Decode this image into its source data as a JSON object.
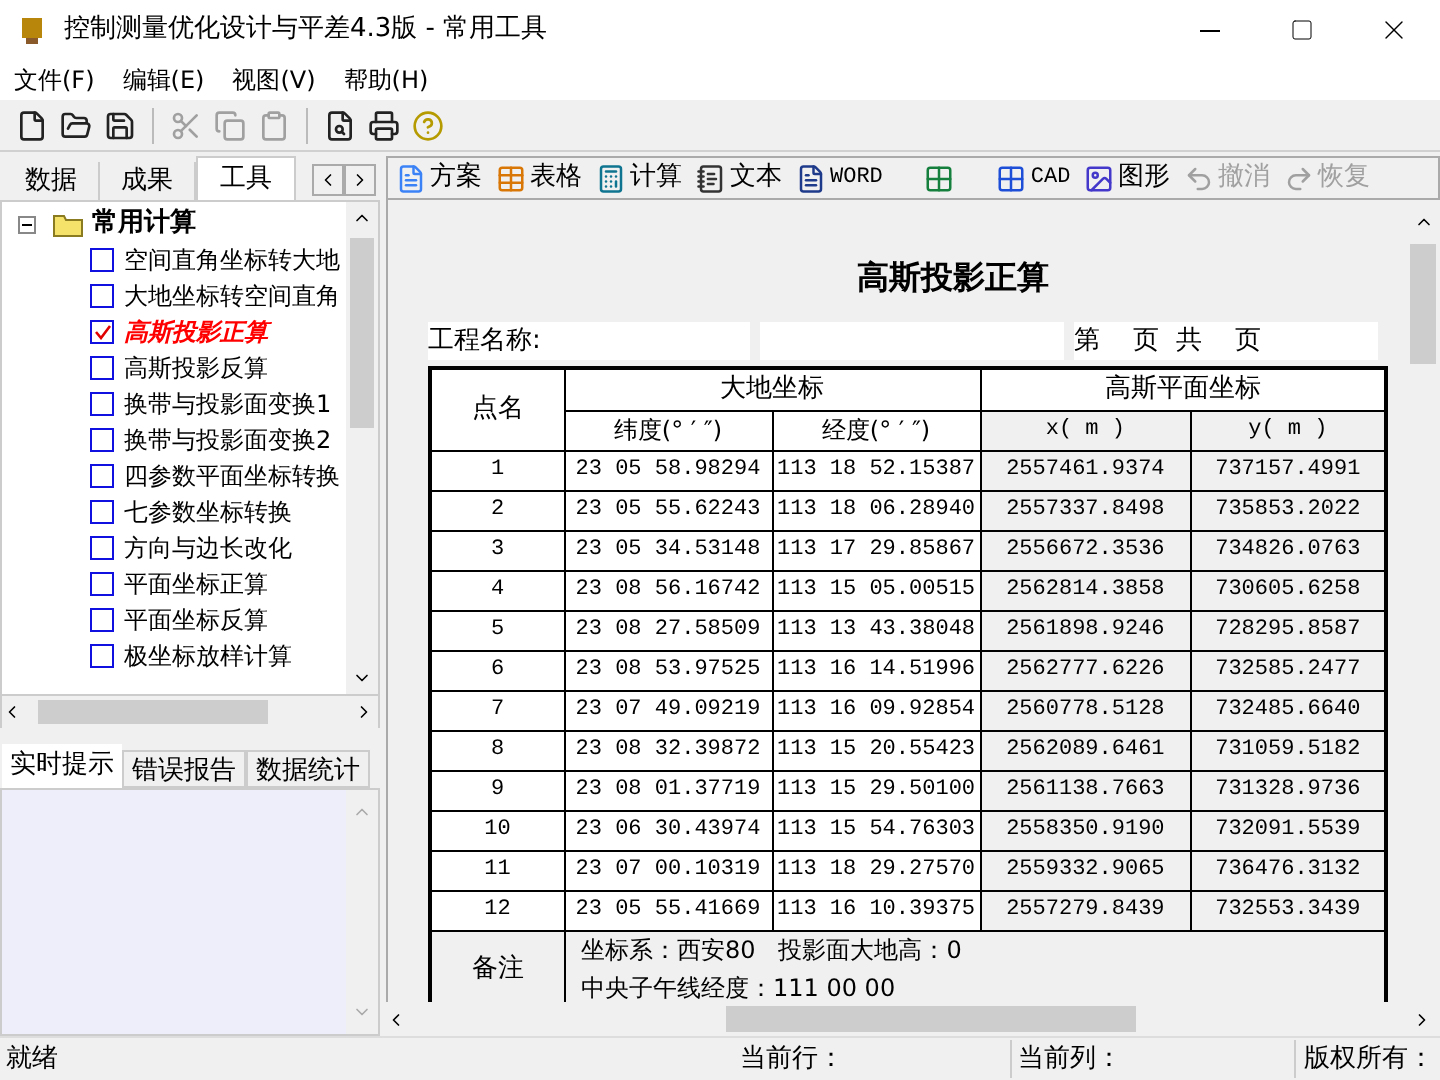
{
  "window": {
    "title": "控制测量优化设计与平差4.3版 - 常用工具"
  },
  "menu": [
    "文件(F)",
    "编辑(E)",
    "视图(V)",
    "帮助(H)"
  ],
  "toolbar": [
    {
      "disabled": false
    },
    {
      "disabled": false
    },
    {
      "disabled": false
    },
    {
      "disabled": true
    },
    {
      "disabled": true
    },
    {
      "disabled": true
    },
    {
      "disabled": false
    },
    {
      "disabled": false
    },
    {
      "disabled": false
    }
  ],
  "left_tabs": [
    {
      "label": "数据",
      "selected": false
    },
    {
      "label": "成果",
      "selected": false
    },
    {
      "label": "工具",
      "selected": true
    }
  ],
  "tree": {
    "label": "常用计算",
    "expanded": true,
    "children": [
      {
        "label": "空间直角坐标转大地",
        "checked": false
      },
      {
        "label": "大地坐标转空间直角",
        "checked": false
      },
      {
        "label": "高斯投影正算",
        "checked": true
      },
      {
        "label": "高斯投影反算",
        "checked": false
      },
      {
        "label": "换带与投影面变换1",
        "checked": false
      },
      {
        "label": "换带与投影面变换2",
        "checked": false
      },
      {
        "label": "四参数平面坐标转换",
        "checked": false
      },
      {
        "label": "七参数坐标转换",
        "checked": false
      },
      {
        "label": "方向与边长改化",
        "checked": false
      },
      {
        "label": "平面坐标正算",
        "checked": false
      },
      {
        "label": "平面坐标反算",
        "checked": false
      },
      {
        "label": "极坐标放样计算",
        "checked": false
      }
    ]
  },
  "bottom_tabs": [
    {
      "label": "实时提示",
      "selected": true
    },
    {
      "label": "错误报告",
      "selected": false
    },
    {
      "label": "数据统计",
      "selected": false
    }
  ],
  "right_toolbar": [
    {
      "label": "方案",
      "disabled": false
    },
    {
      "label": "表格",
      "disabled": false
    },
    {
      "label": "计算",
      "disabled": false
    },
    {
      "label": "文本",
      "disabled": false
    },
    {
      "label": "WORD",
      "disabled": false
    },
    {
      "disabled": false
    },
    {
      "label": "CAD",
      "disabled": false
    },
    {
      "label": "图形",
      "disabled": false
    },
    {
      "label": "撤消",
      "disabled": true
    },
    {
      "label": "恢复",
      "disabled": true
    }
  ],
  "report": {
    "title": "高斯投影正算",
    "project_label": "工程名称:",
    "page_label": "第    页  共    页"
  },
  "table": {
    "group_headers": [
      "大地坐标",
      "高斯平面坐标"
    ],
    "columns": [
      "点名",
      "纬度(° ′ ″)",
      "经度(° ′ ″)",
      "x( m )",
      "y( m )"
    ],
    "rows": [
      [
        "1",
        "23 05 58.98294",
        "113 18 52.15387",
        "2557461.9374",
        "737157.4991"
      ],
      [
        "2",
        "23 05 55.62243",
        "113 18 06.28940",
        "2557337.8498",
        "735853.2022"
      ],
      [
        "3",
        "23 05 34.53148",
        "113 17 29.85867",
        "2556672.3536",
        "734826.0763"
      ],
      [
        "4",
        "23 08 56.16742",
        "113 15 05.00515",
        "2562814.3858",
        "730605.6258"
      ],
      [
        "5",
        "23 08 27.58509",
        "113 13 43.38048",
        "2561898.9246",
        "728295.8587"
      ],
      [
        "6",
        "23 08 53.97525",
        "113 16 14.51996",
        "2562777.6226",
        "732585.2477"
      ],
      [
        "7",
        "23 07 49.09219",
        "113 16 09.92854",
        "2560778.5128",
        "732485.6640"
      ],
      [
        "8",
        "23 08 32.39872",
        "113 15 20.55423",
        "2562089.6461",
        "731059.5182"
      ],
      [
        "9",
        "23 08 01.37719",
        "113 15 29.50100",
        "2561138.7663",
        "731328.9736"
      ],
      [
        "10",
        "23 06 30.43974",
        "113 15 54.76303",
        "2558350.9190",
        "732091.5539"
      ],
      [
        "11",
        "23 07 00.10319",
        "113 18 29.27570",
        "2559332.9065",
        "736476.3132"
      ],
      [
        "12",
        "23 05 55.41669",
        "113 16 10.39375",
        "2557279.8439",
        "732553.3439"
      ]
    ],
    "remark_label": "备注",
    "remark_lines": [
      "坐标系：西安80   投影面大地高：0",
      "中央子午线经度：111 00 00"
    ]
  },
  "status_bar": [
    "就绪",
    "当前行：",
    "当前列：",
    "版权所有："
  ]
}
